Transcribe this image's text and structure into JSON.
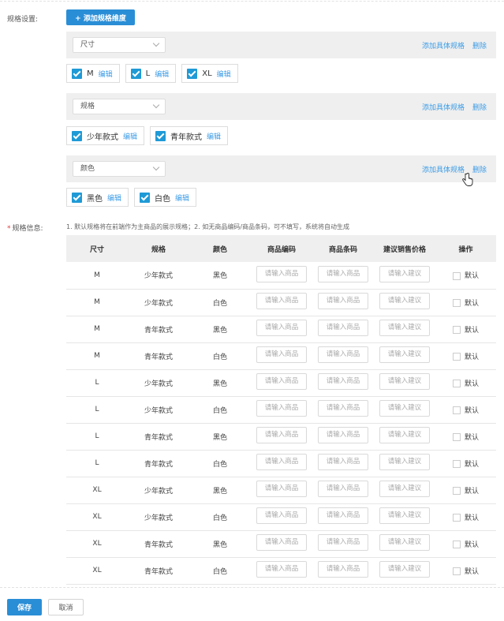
{
  "spec_settings": {
    "label": "规格设置:",
    "add_dimension_button": "+ 添加规格维度",
    "dimensions": [
      {
        "name": "尺寸",
        "add_label": "添加具体规格",
        "delete_label": "删除",
        "values": [
          {
            "name": "M",
            "edit": "编辑"
          },
          {
            "name": "L",
            "edit": "编辑"
          },
          {
            "name": "XL",
            "edit": "编辑"
          }
        ]
      },
      {
        "name": "规格",
        "add_label": "添加具体规格",
        "delete_label": "删除",
        "values": [
          {
            "name": "少年款式",
            "edit": "编辑"
          },
          {
            "name": "青年款式",
            "edit": "编辑"
          }
        ]
      },
      {
        "name": "颜色",
        "add_label": "添加具体规格",
        "delete_label": "删除",
        "values": [
          {
            "name": "黑色",
            "edit": "编辑"
          },
          {
            "name": "白色",
            "edit": "编辑"
          }
        ]
      }
    ]
  },
  "spec_info": {
    "required_mark": "*",
    "label": "规格信息:",
    "note": "1. 默认规格将在前端作为主商品的展示规格；2. 如无商品编码/商品条码，可不填写，系统将自动生成",
    "columns": [
      "尺寸",
      "规格",
      "颜色",
      "商品编码",
      "商品条码",
      "建议销售价格",
      "操作"
    ],
    "placeholders": {
      "code": "请输入商品",
      "barcode": "请输入商品",
      "price": "请输入建议"
    },
    "default_label": "默认",
    "rows": [
      [
        "M",
        "少年款式",
        "黑色"
      ],
      [
        "M",
        "少年款式",
        "白色"
      ],
      [
        "M",
        "青年款式",
        "黑色"
      ],
      [
        "M",
        "青年款式",
        "白色"
      ],
      [
        "L",
        "少年款式",
        "黑色"
      ],
      [
        "L",
        "少年款式",
        "白色"
      ],
      [
        "L",
        "青年款式",
        "黑色"
      ],
      [
        "L",
        "青年款式",
        "白色"
      ],
      [
        "XL",
        "少年款式",
        "黑色"
      ],
      [
        "XL",
        "少年款式",
        "白色"
      ],
      [
        "XL",
        "青年款式",
        "黑色"
      ],
      [
        "XL",
        "青年款式",
        "白色"
      ]
    ]
  },
  "footer": {
    "save": "保存",
    "cancel": "取消"
  },
  "colors": {
    "primary": "#2a8ed6",
    "link": "#3d9ce6",
    "checkbox": "#1f9ad6",
    "required": "#e4393c"
  }
}
